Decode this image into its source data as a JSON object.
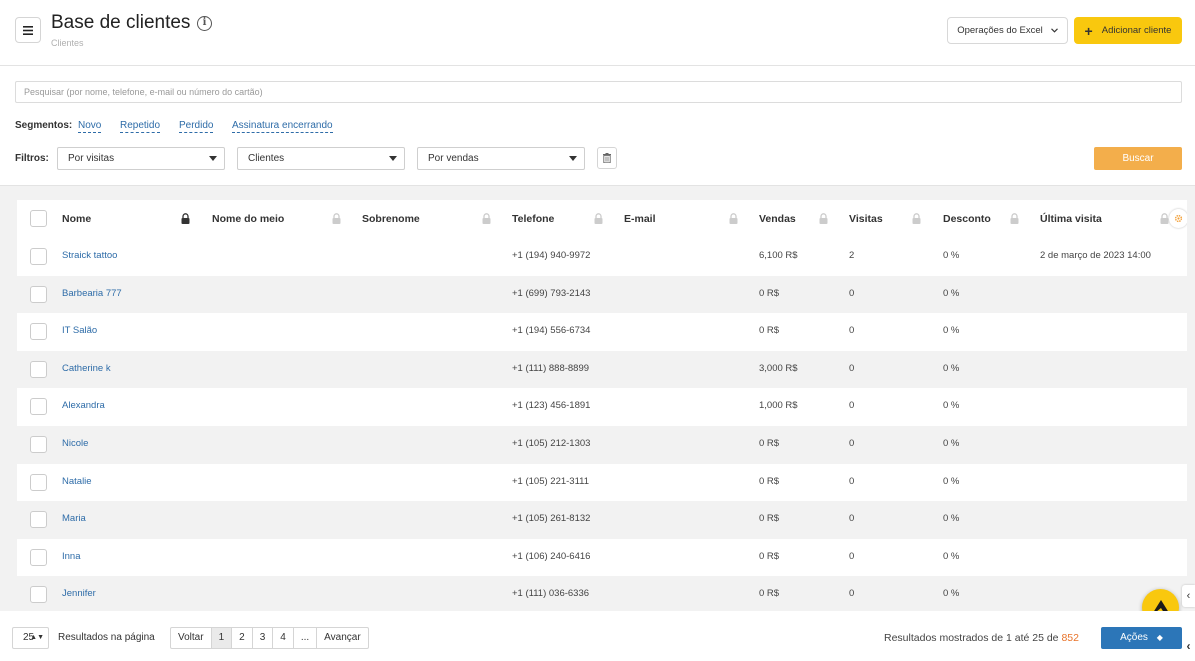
{
  "header": {
    "title": "Base de clientes",
    "breadcrumb": "Clientes",
    "excel_button": "Operações do Excel",
    "add_button": "Adicionar cliente"
  },
  "search": {
    "placeholder": "Pesquisar (por nome, telefone, e-mail ou número do cartão)"
  },
  "segments": {
    "label": "Segmentos:",
    "items": [
      "Novo",
      "Repetido",
      "Perdido",
      "Assinatura encerrando"
    ]
  },
  "filters": {
    "label": "Filtros:",
    "selects": [
      "Por visitas",
      "Clientes",
      "Por vendas"
    ],
    "search_button": "Buscar"
  },
  "table": {
    "columns": [
      "Nome",
      "Nome do meio",
      "Sobrenome",
      "Telefone",
      "E-mail",
      "Vendas",
      "Visitas",
      "Desconto",
      "Última visita"
    ],
    "rows": [
      {
        "name": "Straick tattoo",
        "phone": "+1 (194) 940-9972",
        "sales": "6,100 R$",
        "visits": "2",
        "discount": "0 %",
        "last_visit": "2 de março de 2023 14:00"
      },
      {
        "name": "Barbearia 777",
        "phone": "+1 (699) 793-2143",
        "sales": "0 R$",
        "visits": "0",
        "discount": "0 %",
        "last_visit": ""
      },
      {
        "name": "IT Salão",
        "phone": "+1 (194) 556-6734",
        "sales": "0 R$",
        "visits": "0",
        "discount": "0 %",
        "last_visit": ""
      },
      {
        "name": "Catherine k",
        "phone": "+1 (111) 888-8899",
        "sales": "3,000 R$",
        "visits": "0",
        "discount": "0 %",
        "last_visit": ""
      },
      {
        "name": "Alexandra",
        "phone": "+1 (123) 456-1891",
        "sales": "1,000 R$",
        "visits": "0",
        "discount": "0 %",
        "last_visit": ""
      },
      {
        "name": "Nicole",
        "phone": "+1 (105) 212-1303",
        "sales": "0 R$",
        "visits": "0",
        "discount": "0 %",
        "last_visit": ""
      },
      {
        "name": "Natalie",
        "phone": "+1 (105) 221-3111",
        "sales": "0 R$",
        "visits": "0",
        "discount": "0 %",
        "last_visit": ""
      },
      {
        "name": "Maria",
        "phone": "+1 (105) 261-8132",
        "sales": "0 R$",
        "visits": "0",
        "discount": "0 %",
        "last_visit": ""
      },
      {
        "name": "Inna",
        "phone": "+1 (106) 240-6416",
        "sales": "0 R$",
        "visits": "0",
        "discount": "0 %",
        "last_visit": ""
      },
      {
        "name": "Jennifer",
        "phone": "+1 (111) 036-6336",
        "sales": "0 R$",
        "visits": "0",
        "discount": "0 %",
        "last_visit": ""
      }
    ]
  },
  "footer": {
    "per_page": "25",
    "per_page_label": "Resultados na página",
    "prev": "Voltar",
    "pages": [
      "1",
      "2",
      "3",
      "4",
      "..."
    ],
    "next": "Avançar",
    "results_text": "Resultados mostrados de 1 até 25 de",
    "total": "852",
    "actions_button": "Ações"
  },
  "colors": {
    "accent_yellow": "#f9c80e",
    "search_orange": "#f3ae4b",
    "link_blue": "#2e6ca8",
    "actions_blue": "#2c76b8"
  },
  "icons": [
    "hamburger-icon",
    "info-icon",
    "chevron-down-icon",
    "plus-icon",
    "trash-icon",
    "lock-icon",
    "gear-icon",
    "logo-icon"
  ]
}
